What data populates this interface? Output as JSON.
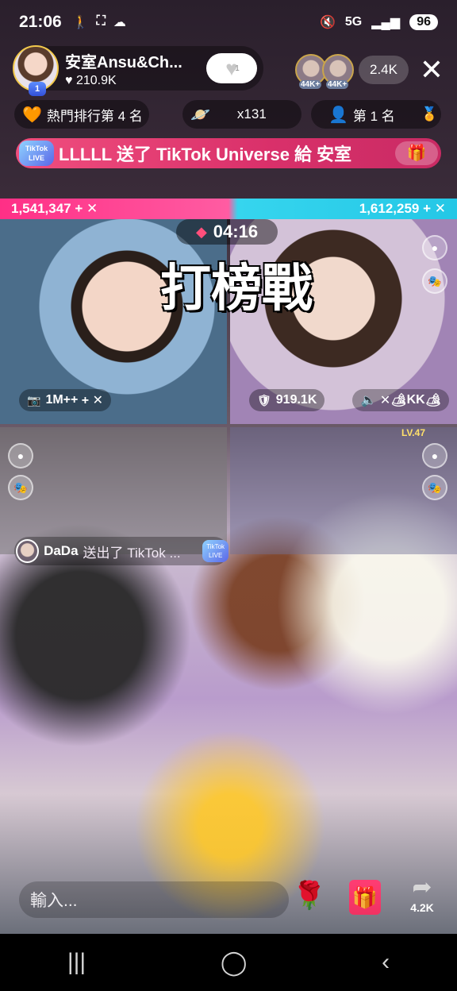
{
  "status": {
    "time": "21:06",
    "battery": "96",
    "signal_label": "5G"
  },
  "host": {
    "name": "安室Ansu&Ch...",
    "likes": "210.9K",
    "level": "1",
    "follow_count": "1"
  },
  "viewers": {
    "avatar_a_badge": "44K+",
    "avatar_b_badge": "44K+",
    "count": "2.4K"
  },
  "chips": {
    "rank": "熱門排行第 4 名",
    "multiplier": "x131",
    "first_place": "第 1 名"
  },
  "banner": {
    "logo": "TikTok LIVE",
    "text": "LLLLL 送了 TikTok Universe 給 安室"
  },
  "battle": {
    "left_score": "1,541,347",
    "right_score": "1,612,259",
    "timer": "04:16",
    "title": "打榜戰",
    "tl_count": "1M++",
    "tr_count": "919.1K",
    "tr_tag": "KK",
    "level_label": "LV.47"
  },
  "chat": {
    "name": "DaDa",
    "text": "送出了 TikTok ...",
    "logo": "TikTok LIVE"
  },
  "bottom": {
    "input_placeholder": "輸入...",
    "share_count": "4.2K"
  },
  "icons": {
    "close": "close-icon",
    "gift": "gift-icon",
    "rose": "rose-icon",
    "share": "share-icon",
    "heart": "heart-icon"
  },
  "colors": {
    "score_left": "#ff2f86",
    "score_right": "#24c7e6",
    "banner": "#d9306a",
    "gift": "#f03262"
  }
}
